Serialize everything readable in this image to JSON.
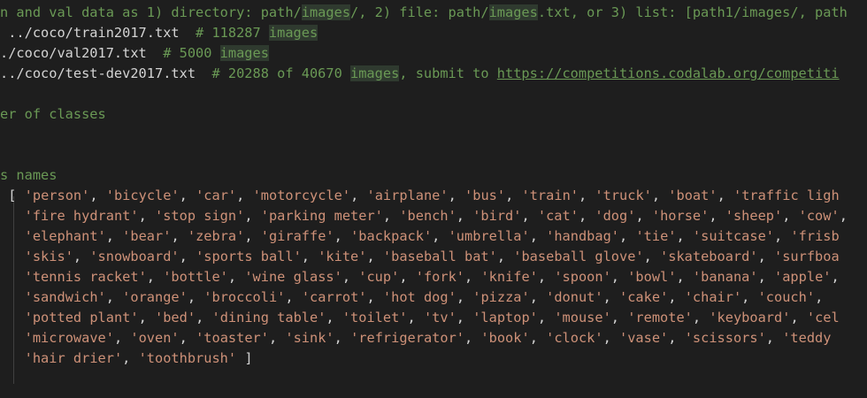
{
  "lines": {
    "l0_pre": "n and val data as 1) directory: path/",
    "l0_hl1": "images",
    "l0_mid": "/, 2) file: path/",
    "l0_hl2": "images",
    "l0_post": ".txt, or 3) list: [path1/images/, path",
    "l1_path": " ../coco/train2017.txt",
    "l1_comment_pre": "  # 118287 ",
    "l1_hl": "images",
    "l2_path": "./coco/val2017.txt",
    "l2_comment_pre": "  # 5000 ",
    "l2_hl": "images",
    "l3_path": "../coco/test-dev2017.txt",
    "l3_comment_pre": "  # 20288 of 40670 ",
    "l3_hl": "images",
    "l3_comment_mid": ", submit to ",
    "l3_link": "https://competitions.codalab.org/competiti",
    "l5_comment": "er of classes",
    "l8_comment": "s names"
  },
  "names": [
    "'person'",
    "'bicycle'",
    "'car'",
    "'motorcycle'",
    "'airplane'",
    "'bus'",
    "'train'",
    "'truck'",
    "'boat'",
    "'traffic ligh",
    "'fire hydrant'",
    "'stop sign'",
    "'parking meter'",
    "'bench'",
    "'bird'",
    "'cat'",
    "'dog'",
    "'horse'",
    "'sheep'",
    "'cow'",
    "'elephant'",
    "'bear'",
    "'zebra'",
    "'giraffe'",
    "'backpack'",
    "'umbrella'",
    "'handbag'",
    "'tie'",
    "'suitcase'",
    "'frisb",
    "'skis'",
    "'snowboard'",
    "'sports ball'",
    "'kite'",
    "'baseball bat'",
    "'baseball glove'",
    "'skateboard'",
    "'surfboa",
    "'tennis racket'",
    "'bottle'",
    "'wine glass'",
    "'cup'",
    "'fork'",
    "'knife'",
    "'spoon'",
    "'bowl'",
    "'banana'",
    "'apple'",
    "'sandwich'",
    "'orange'",
    "'broccoli'",
    "'carrot'",
    "'hot dog'",
    "'pizza'",
    "'donut'",
    "'cake'",
    "'chair'",
    "'couch'",
    "'potted plant'",
    "'bed'",
    "'dining table'",
    "'toilet'",
    "'tv'",
    "'laptop'",
    "'mouse'",
    "'remote'",
    "'keyboard'",
    "'cel",
    "'microwave'",
    "'oven'",
    "'toaster'",
    "'sink'",
    "'refrigerator'",
    "'book'",
    "'clock'",
    "'vase'",
    "'scissors'",
    "'teddy",
    "'hair drier'",
    "'toothbrush'"
  ],
  "open_bracket": "[",
  "close_bracket": "]",
  "last_line_partial": "  ."
}
